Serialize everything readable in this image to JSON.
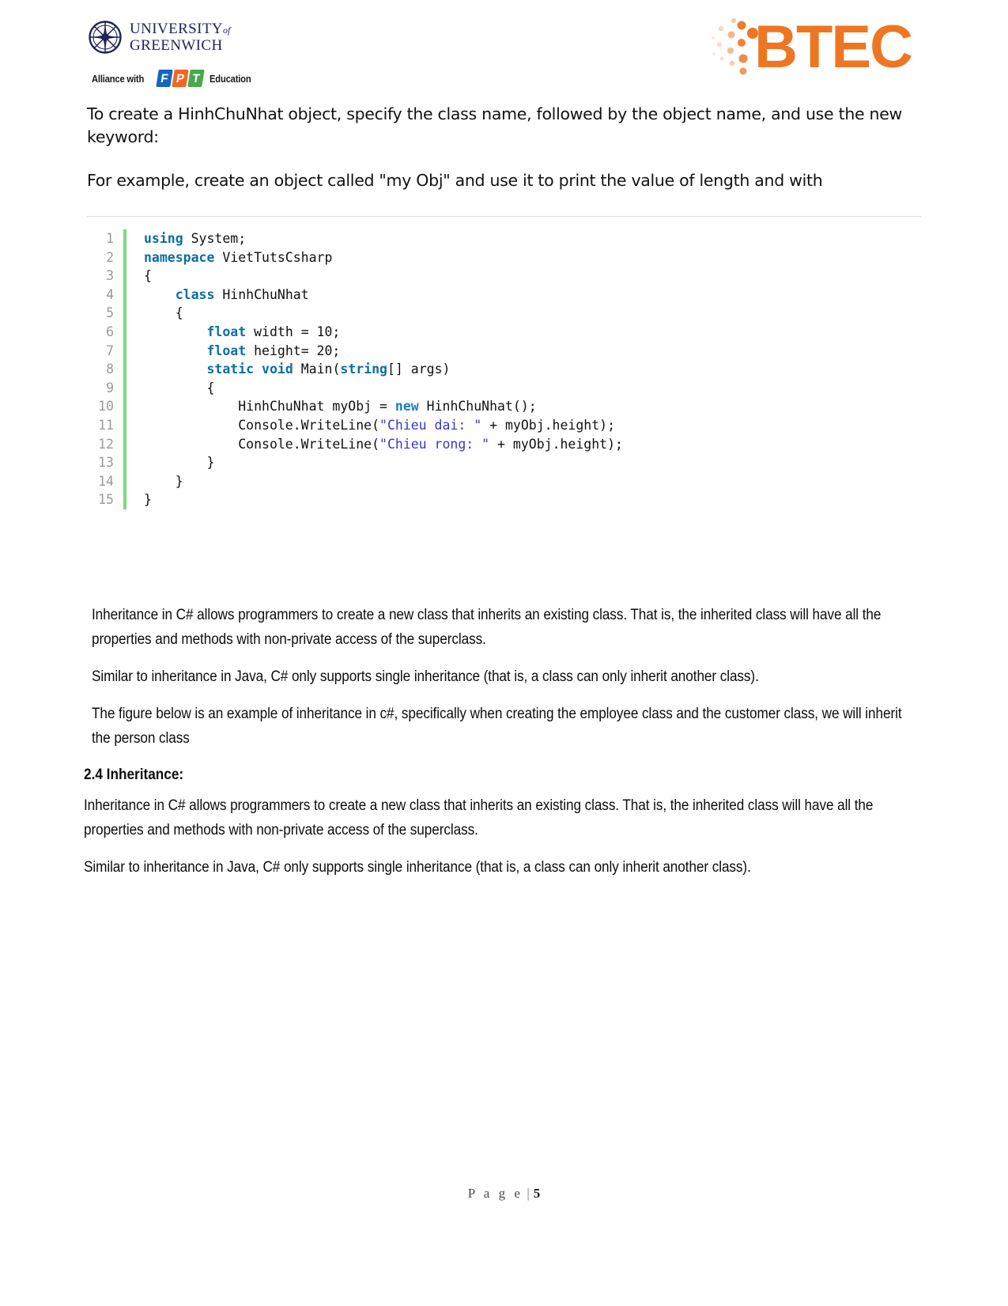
{
  "header": {
    "university": {
      "line1": "UNIVERSITY",
      "of": "of",
      "line2": "GREENWICH",
      "crest_icon": "compass-rose-crest-icon"
    },
    "alliance": {
      "prefix": "Alliance with",
      "letters": [
        "F",
        "P",
        "T"
      ],
      "suffix": "Education"
    },
    "btec": {
      "wordmark": "BTEC",
      "color": "#ee7623",
      "dots_icon": "btec-dot-cluster-icon"
    }
  },
  "intro": {
    "paragraph1": "To create a HinhChuNhat object, specify the class name, followed by the object name, and use the new keyword:",
    "paragraph2": "For example, create an object called \"my Obj\" and use it to print the value of length and with"
  },
  "code_block": {
    "language": "csharp",
    "line_numbers": [
      "1",
      "2",
      "3",
      "4",
      "5",
      "6",
      "7",
      "8",
      "9",
      "10",
      "11",
      "12",
      "13",
      "14",
      "15"
    ],
    "lines": [
      "using System;",
      "namespace VietTutsCsharp",
      "{",
      "    class HinhChuNhat",
      "    {",
      "        float width = 10;",
      "        float height= 20;",
      "        static void Main(string[] args)",
      "        {",
      "            HinhChuNhat myObj = new HinhChuNhat();",
      "            Console.WriteLine(\"Chieu dai: \" + myObj.height);",
      "            Console.WriteLine(\"Chieu rong: \" + myObj.height);",
      "        }",
      "    }",
      "}"
    ],
    "accent_color": "#7ed97e",
    "keyword_color": "#0b6fa4",
    "string_color": "#3838c4"
  },
  "body": {
    "paragraphs_upper": [
      "Inheritance in C# allows programmers to create a new class that inherits an existing class. That is, the inherited class will have all the properties and methods with non-private access of the superclass.",
      "Similar to inheritance in Java, C# only supports single inheritance (that is, a class can only inherit another class).",
      "The figure below is an example of inheritance in c#, specifically when creating the employee class and the customer class, we will inherit the person class"
    ],
    "heading": "2.4 Inheritance:",
    "paragraphs_lower": [
      "Inheritance in C# allows programmers to create a new class that inherits an existing class. That is, the inherited class will have all the properties and methods with non-private access of the superclass.",
      "Similar to inheritance in Java, C# only supports single inheritance (that is, a class can only inherit another class)."
    ]
  },
  "footer": {
    "page_label": "P a g e",
    "separator": "|",
    "page_number": "5"
  }
}
